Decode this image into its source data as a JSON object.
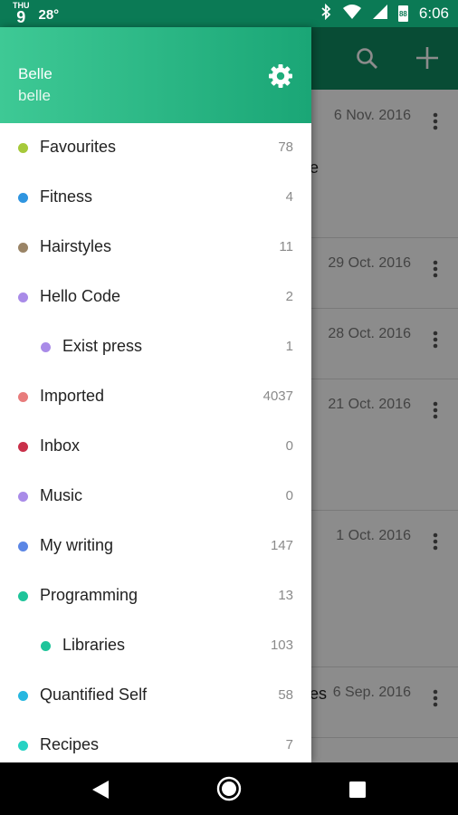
{
  "status_bar": {
    "day": "THU",
    "date": "9",
    "temperature": "28°",
    "time": "6:06",
    "battery": "88"
  },
  "background_list": {
    "rows": [
      {
        "date": "6 Nov. 2016",
        "snippet": "e"
      },
      {
        "date": "29 Oct. 2016",
        "snippet": ""
      },
      {
        "date": "28 Oct. 2016",
        "snippet": ""
      },
      {
        "date": "21 Oct. 2016",
        "snippet": ""
      },
      {
        "date": "1 Oct. 2016",
        "snippet": ""
      },
      {
        "date": "6 Sep. 2016",
        "snippet": "es"
      }
    ]
  },
  "drawer": {
    "user_name": "Belle",
    "user_handle": "belle",
    "folders": [
      {
        "name": "Favourites",
        "count": "78",
        "color": "#a6c93a",
        "indent": false
      },
      {
        "name": "Fitness",
        "count": "4",
        "color": "#2f95e0",
        "indent": false
      },
      {
        "name": "Hairstyles",
        "count": "11",
        "color": "#9a8466",
        "indent": false
      },
      {
        "name": "Hello Code",
        "count": "2",
        "color": "#a98be8",
        "indent": false
      },
      {
        "name": "Exist press",
        "count": "1",
        "color": "#a98be8",
        "indent": true
      },
      {
        "name": "Imported",
        "count": "4037",
        "color": "#e87c7c",
        "indent": false
      },
      {
        "name": "Inbox",
        "count": "0",
        "color": "#c9304a",
        "indent": false
      },
      {
        "name": "Music",
        "count": "0",
        "color": "#a98be8",
        "indent": false
      },
      {
        "name": "My writing",
        "count": "147",
        "color": "#5b86e5",
        "indent": false
      },
      {
        "name": "Programming",
        "count": "13",
        "color": "#1fc49a",
        "indent": false
      },
      {
        "name": "Libraries",
        "count": "103",
        "color": "#1fc49a",
        "indent": true
      },
      {
        "name": "Quantified Self",
        "count": "58",
        "color": "#27b7e0",
        "indent": false
      },
      {
        "name": "Recipes",
        "count": "7",
        "color": "#27d2c3",
        "indent": false
      }
    ]
  }
}
